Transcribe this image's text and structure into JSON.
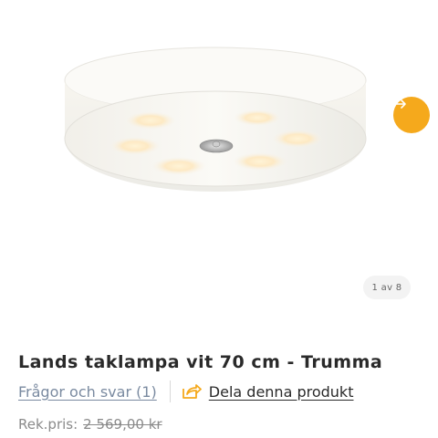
{
  "gallery": {
    "counter": "1 av 8",
    "next_icon": "arrow-right-icon"
  },
  "product": {
    "title": "Lands taklampa vit 70 cm - Trumma",
    "qa_link": "Frågor och svar (1)",
    "share_icon": "share-icon",
    "share_link": "Dela denna produkt",
    "price_label": "Rek.pris:",
    "price_old": "2 569,00 kr"
  },
  "colors": {
    "accent": "#f5a91c",
    "link_muted": "#7a8aa0",
    "text": "#2a2a2a"
  }
}
